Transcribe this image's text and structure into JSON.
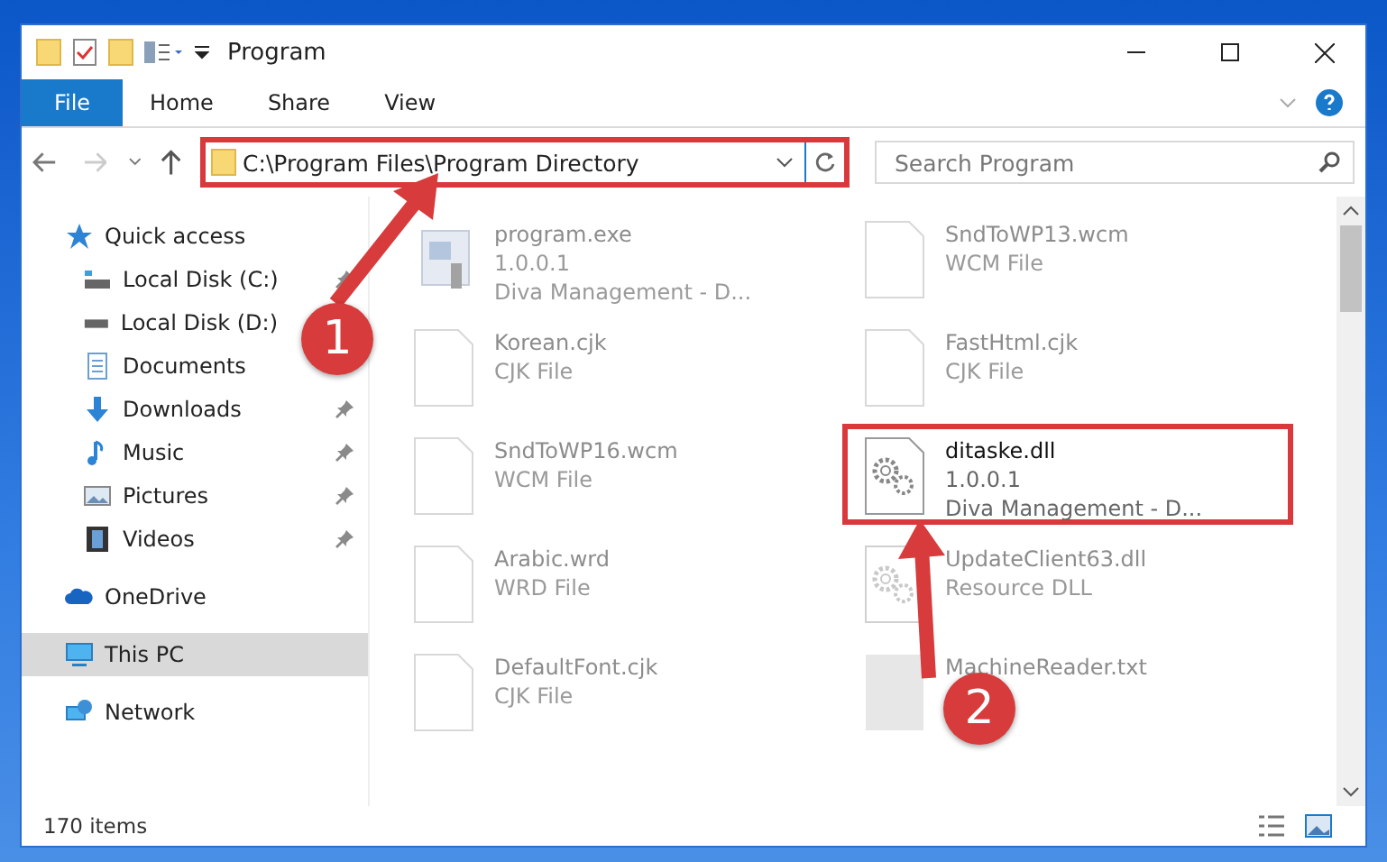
{
  "window": {
    "title": "Program"
  },
  "ribbon": {
    "tabs": [
      {
        "label": "File",
        "selected": true
      },
      {
        "label": "Home",
        "selected": false
      },
      {
        "label": "Share",
        "selected": false
      },
      {
        "label": "View",
        "selected": false
      }
    ]
  },
  "address": {
    "path": "C:\\Program Files\\Program Directory",
    "highlighted": true
  },
  "search": {
    "placeholder": "Search Program"
  },
  "sidebar": {
    "items": [
      {
        "label": "Quick access",
        "kind": "star",
        "pinned": false,
        "selected": false,
        "children": [
          {
            "label": "Local Disk (C:)",
            "kind": "disk-c",
            "pinned": true,
            "selected": false
          },
          {
            "label": "Local Disk (D:)",
            "kind": "disk",
            "selected": false
          },
          {
            "label": "Documents",
            "kind": "documents",
            "selected": false
          },
          {
            "label": "Downloads",
            "kind": "downloads",
            "pinned": true,
            "selected": false
          },
          {
            "label": "Music",
            "kind": "music",
            "pinned": true,
            "selected": false
          },
          {
            "label": "Pictures",
            "kind": "pictures",
            "pinned": true,
            "selected": false
          },
          {
            "label": "Videos",
            "kind": "videos",
            "pinned": true,
            "selected": false
          }
        ]
      },
      {
        "label": "OneDrive",
        "kind": "cloud",
        "pinned": false,
        "selected": false
      },
      {
        "label": "This PC",
        "kind": "pc",
        "pinned": false,
        "selected": true
      },
      {
        "label": "Network",
        "kind": "network",
        "pinned": false,
        "selected": false
      }
    ]
  },
  "files": [
    {
      "name": "program.exe",
      "lines": [
        "1.0.0.1",
        "Diva Management - D..."
      ],
      "kind": "app",
      "faded": true,
      "highlighted": false
    },
    {
      "name": "SndToWP13.wcm",
      "lines": [
        "WCM File"
      ],
      "kind": "doc",
      "faded": true,
      "highlighted": false
    },
    {
      "name": "Korean.cjk",
      "lines": [
        "CJK File"
      ],
      "kind": "doc",
      "faded": true,
      "highlighted": false
    },
    {
      "name": "FastHtml.cjk",
      "lines": [
        "CJK File"
      ],
      "kind": "doc",
      "faded": true,
      "highlighted": false
    },
    {
      "name": "SndToWP16.wcm",
      "lines": [
        "WCM File"
      ],
      "kind": "doc",
      "faded": true,
      "highlighted": false
    },
    {
      "name": "ditaske.dll",
      "lines": [
        "1.0.0.1",
        "Diva Management - D..."
      ],
      "kind": "dll",
      "faded": false,
      "highlighted": true
    },
    {
      "name": "Arabic.wrd",
      "lines": [
        "WRD File"
      ],
      "kind": "doc",
      "faded": true,
      "highlighted": false
    },
    {
      "name": "UpdateClient63.dll",
      "lines": [
        "Resource DLL"
      ],
      "kind": "dll",
      "faded": true,
      "highlighted": false
    },
    {
      "name": "DefaultFont.cjk",
      "lines": [
        "CJK File"
      ],
      "kind": "doc",
      "faded": true,
      "highlighted": false
    },
    {
      "name": "MachineReader.txt",
      "kind": "blank",
      "faded": true,
      "highlighted": false
    }
  ],
  "status_bar": {
    "text": "170 items"
  },
  "annotations": [
    {
      "number": "1"
    },
    {
      "number": "2"
    }
  ]
}
